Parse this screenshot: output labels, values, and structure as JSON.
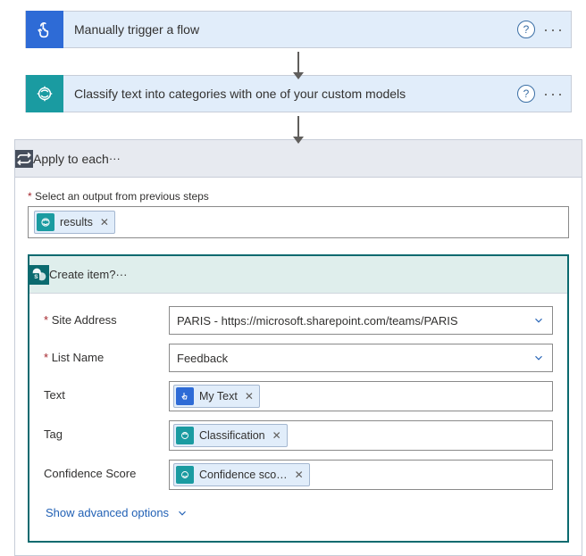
{
  "step1": {
    "title": "Manually trigger a flow"
  },
  "step2": {
    "title": "Classify text into categories with one of your custom models"
  },
  "loop": {
    "title": "Apply to each",
    "output_label": "Select an output from previous steps",
    "output_token": "results"
  },
  "create": {
    "title": "Create item",
    "rows": {
      "site": {
        "label": "Site Address",
        "required": true,
        "value": "PARIS - https://microsoft.sharepoint.com/teams/PARIS"
      },
      "list": {
        "label": "List Name",
        "required": true,
        "value": "Feedback"
      },
      "text": {
        "label": "Text",
        "token": "My Text"
      },
      "tag": {
        "label": "Tag",
        "token": "Classification"
      },
      "conf": {
        "label": "Confidence Score",
        "token": "Confidence sco…"
      }
    },
    "advanced": "Show advanced options"
  }
}
